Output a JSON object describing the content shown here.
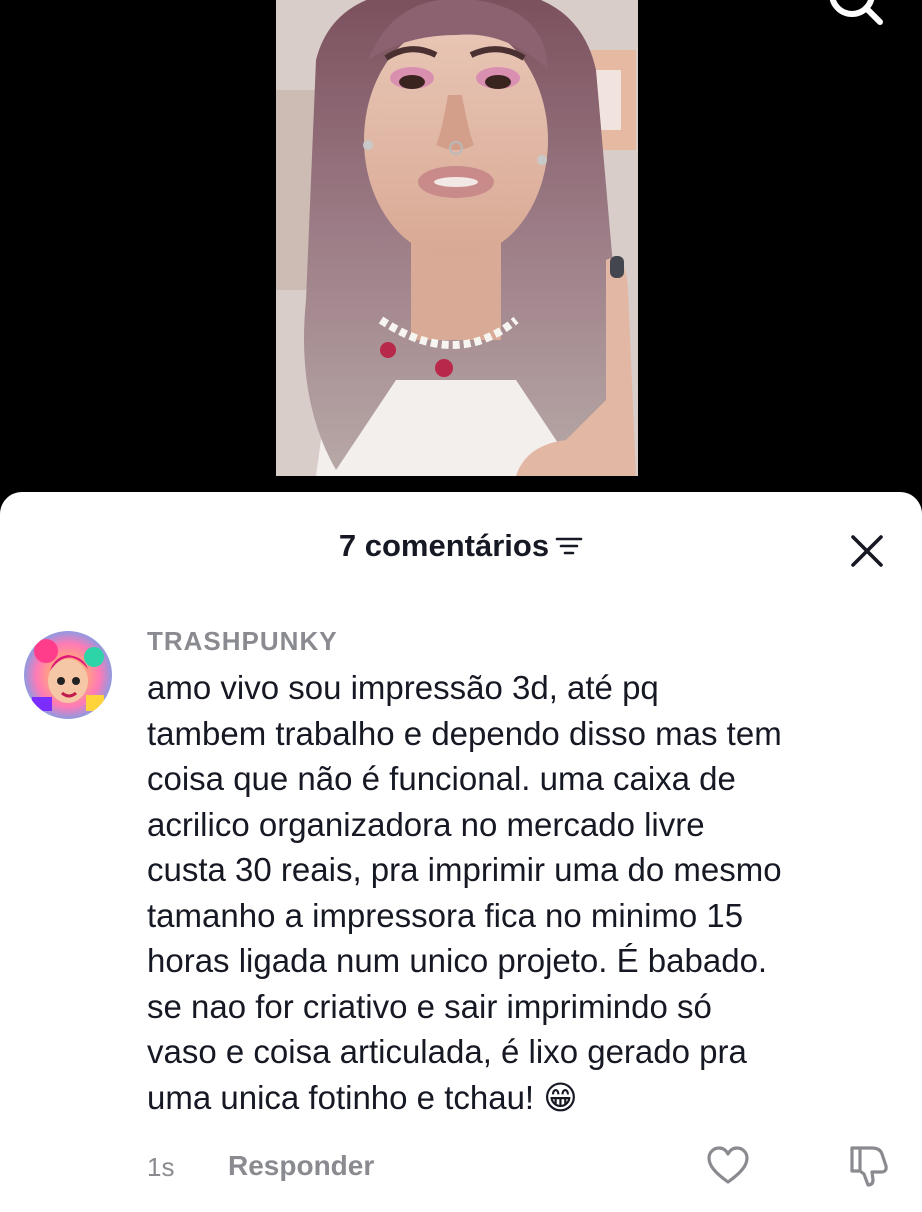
{
  "header": {
    "icon": "search-icon"
  },
  "comments_panel": {
    "title": "7 comentários",
    "icons": {
      "filter": "sort-filter-icon",
      "close": "close-icon"
    }
  },
  "comment": {
    "username": "TRASHPUNKY",
    "text_lines": [
      "amo vivo sou impressão 3d, até pq",
      "tambem trabalho e dependo disso mas tem",
      "coisa que não é funcional. uma caixa de",
      "acrilico organizadora no mercado livre",
      "custa 30 reais, pra imprimir uma do mesmo",
      "tamanho a impressora fica no minimo 15",
      "horas ligada num unico projeto. É babado.",
      "se nao for criativo e sair imprimindo só",
      "vaso e coisa articulada, é lixo gerado pra",
      "uma unica fotinho e tchau! 😁"
    ],
    "timestamp": "1s",
    "reply_label": "Responder",
    "icons": {
      "like": "heart-outline-icon",
      "dislike": "thumbs-down-icon"
    }
  },
  "colors": {
    "text_primary": "#161823",
    "text_secondary": "#8a8b91",
    "background": "#000000",
    "sheet": "#ffffff"
  }
}
